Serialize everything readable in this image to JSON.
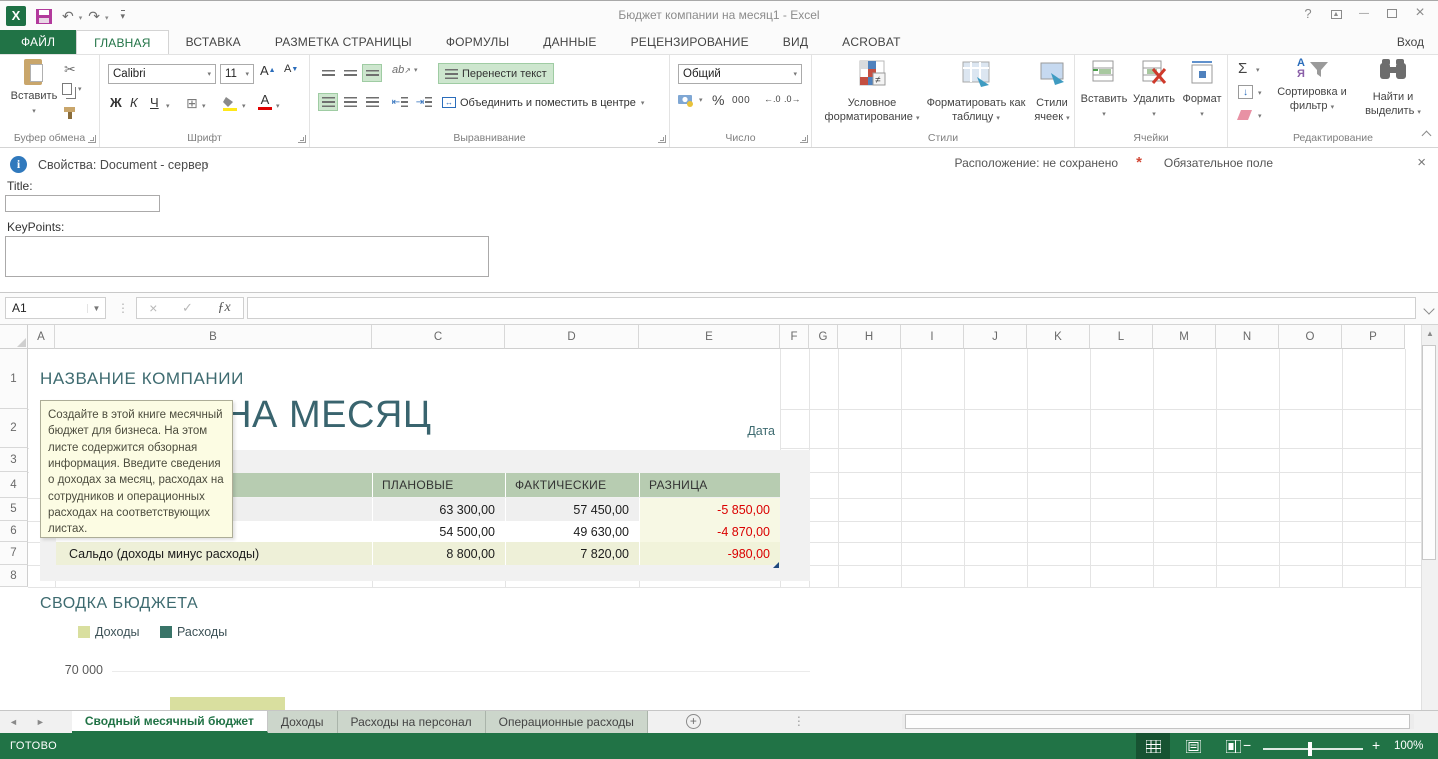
{
  "colors": {
    "excel_green": "#217346",
    "heading_teal": "#3e6b70",
    "table_header_green": "#b7ccb1",
    "diff_column_bg": "#f7f8e4",
    "negative_red": "#da0000",
    "income_color": "#d9df9f",
    "expense_color": "#397468",
    "tooltip_bg": "#fcfce3"
  },
  "icons": {
    "undo": "↶",
    "redo": "↷",
    "customize": "▾",
    "help": "?",
    "minimize": "—",
    "close": "×",
    "cut": "✂",
    "sum": "Σ",
    "check": "✓",
    "cancel": "×",
    "fx": "ƒx",
    "percent": "%",
    "thousands": "000",
    "inc_decimal": "←.0",
    "dec_decimal": ".0→",
    "dots": "⋮",
    "nav_left": "◄",
    "nav_right": "►",
    "new_sheet": "+",
    "up_arrow": "▲",
    "borders": "⊞",
    "info": "i"
  },
  "title_bar": {
    "app_title": "Бюджет компании на месяц1 - Excel",
    "sign_in": "Вход"
  },
  "ribbon": {
    "file_tab": "ФАЙЛ",
    "tabs": [
      "ГЛАВНАЯ",
      "ВСТАВКА",
      "РАЗМЕТКА СТРАНИЦЫ",
      "ФОРМУЛЫ",
      "ДАННЫЕ",
      "РЕЦЕНЗИРОВАНИЕ",
      "ВИД",
      "ACROBAT"
    ],
    "active_tab": "ГЛАВНАЯ",
    "clipboard": {
      "label": "Буфер обмена",
      "paste": "Вставить"
    },
    "font": {
      "label": "Шрифт",
      "family": "Calibri",
      "size": "11",
      "bold": "Ж",
      "italic": "К",
      "underline": "Ч",
      "grow": "А",
      "shrink": "А",
      "color_letter": "А"
    },
    "alignment": {
      "label": "Выравнивание",
      "wrap_text": "Перенести текст",
      "merge_center": "Объединить и поместить в центре",
      "orientation": "ab"
    },
    "number": {
      "label": "Число",
      "format": "Общий"
    },
    "styles": {
      "label": "Стили",
      "conditional": "Условное форматирование",
      "format_as_table": "Форматировать как таблицу",
      "cell_styles": "Стили ячеек"
    },
    "cells": {
      "label": "Ячейки",
      "insert": "Вставить",
      "delete": "Удалить",
      "format": "Формат"
    },
    "editing": {
      "label": "Редактирование",
      "sort_filter": "Сортировка и фильтр",
      "find_select": "Найти и выделить",
      "sort_letters": "АЯ"
    }
  },
  "doc_panel": {
    "properties_label": "Свойства: Document - сервер",
    "title_label": "Title:",
    "title_value": "",
    "keypoints_label": "KeyPoints:",
    "keypoints_value": "",
    "location": "Расположение: не сохранено",
    "required_marker": "*",
    "required_label": "Обязательное поле"
  },
  "formula_bar": {
    "name_box": "A1",
    "formula_value": ""
  },
  "sheet": {
    "columns": [
      "A",
      "B",
      "C",
      "D",
      "E",
      "F",
      "G",
      "H",
      "I",
      "J",
      "K",
      "L",
      "M",
      "N",
      "O",
      "P"
    ],
    "rows": [
      "1",
      "2",
      "3",
      "4",
      "5",
      "6",
      "7",
      "8"
    ],
    "company_name": "НАЗВАНИЕ КОМПАНИИ",
    "page_title": "БЮДЖЕТ НА МЕСЯЦ",
    "date_label": "Дата",
    "comment_tooltip": "Создайте в этой книге месячный бюджет для бизнеса. На этом листе содержится обзорная информация. Введите сведения о доходах за месяц, расходах на сотрудников и операционных расходах на соответствующих листах.",
    "table": {
      "headers": [
        "",
        "ПЛАНОВЫЕ",
        "ФАКТИЧЕСКИЕ",
        "РАЗНИЦА"
      ],
      "rows": [
        {
          "label": "",
          "plan": "63 300,00",
          "fact": "57 450,00",
          "diff": "-5 850,00"
        },
        {
          "label": "",
          "plan": "54 500,00",
          "fact": "49 630,00",
          "diff": "-4 870,00"
        },
        {
          "label": "Сальдо (доходы минус расходы)",
          "plan": "8 800,00",
          "fact": "7 820,00",
          "diff": "-980,00"
        }
      ]
    },
    "summary_heading": "СВОДКА БЮДЖЕТА",
    "legend": [
      {
        "label": "Доходы",
        "color": "#d9df9f"
      },
      {
        "label": "Расходы",
        "color": "#397468"
      }
    ],
    "axis_tick": "70 000"
  },
  "chart_data": {
    "type": "bar",
    "title": "СВОДКА БЮДЖЕТА",
    "legend": [
      "Доходы",
      "Расходы"
    ],
    "visible_axis_ticks": [
      "70 000"
    ],
    "note": "chart mostly cut off at bottom of viewport; only top of one light-green bar visible",
    "visible_bars": [
      {
        "series": "Доходы",
        "color": "#d9df9f"
      }
    ]
  },
  "sheet_tabs": {
    "tabs": [
      {
        "label": "Сводный месячный бюджет",
        "active": true
      },
      {
        "label": "Доходы",
        "active": false
      },
      {
        "label": "Расходы на персонал",
        "active": false
      },
      {
        "label": "Операционные расходы",
        "active": false
      }
    ]
  },
  "status_bar": {
    "mode": "ГОТОВО",
    "zoom": "100%"
  }
}
